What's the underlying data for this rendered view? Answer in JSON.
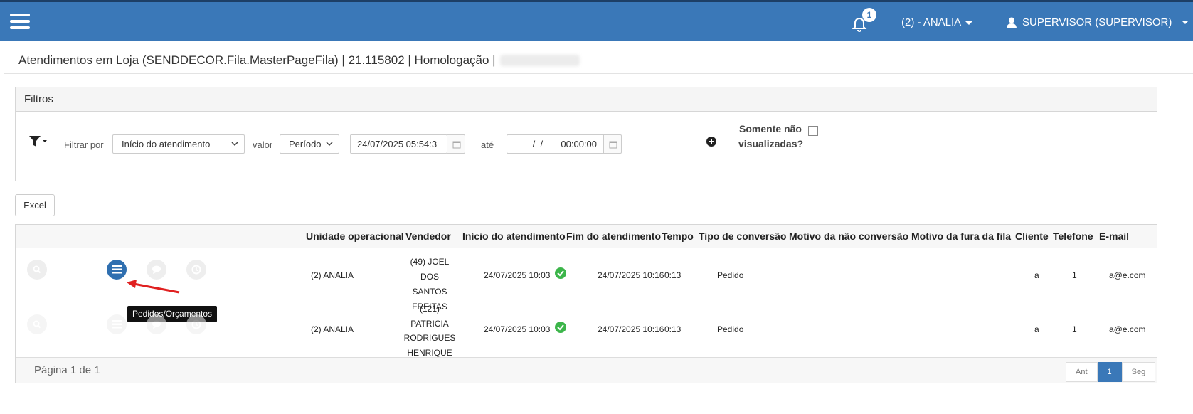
{
  "header": {
    "notifications_count": "1",
    "unit_menu_label": "(2) - ANALIA",
    "user_menu_label": "SUPERVISOR (SUPERVISOR)",
    "accent_color": "#3a78b8"
  },
  "page": {
    "title": "Atendimentos em Loja (SENDDECOR.Fila.MasterPageFila) | 21.115802 | Homologação |"
  },
  "filters": {
    "panel_title": "Filtros",
    "filter_by_label": "Filtrar por",
    "filter_by_value": "Início do atendimento",
    "value_label": "valor",
    "value_select": "Período",
    "date_from": "24/07/2025 05:54:3",
    "until_label": "até",
    "date_to": "  /  /       00:00:00",
    "only_unviewed_label": "Somente não visualizadas?"
  },
  "toolbar": {
    "excel_label": "Excel"
  },
  "table": {
    "columns": {
      "unit": "Unidade operacional",
      "seller": "Vendedor",
      "start": "Início do atendimento",
      "end": "Fim do atendimento",
      "time": "Tempo",
      "conversion_type": "Tipo de conversão",
      "no_conversion_reason": "Motivo da não conversão",
      "queue_skip_reason": "Motivo da fura da fila",
      "client": "Cliente",
      "phone": "Telefone",
      "email": "E-mail"
    },
    "rows": [
      {
        "unit": "(2) ANALIA",
        "seller": [
          "(49) JOEL",
          "DOS SANTOS",
          "FREITAS"
        ],
        "start": "24/07/2025 10:03",
        "end": "24/07/2025 10:16",
        "time": "0:13",
        "conversion_type": "Pedido",
        "client": "a",
        "phone": "1",
        "email": "a@e.com"
      },
      {
        "unit": "(2) ANALIA",
        "seller": [
          "(121)",
          "PATRICIA",
          "RODRIGUES",
          "HENRIQUE"
        ],
        "start": "24/07/2025 10:03",
        "end": "24/07/2025 10:16",
        "time": "0:13",
        "conversion_type": "Pedido",
        "client": "a",
        "phone": "1",
        "email": "a@e.com"
      }
    ],
    "tooltip": "Pedidos/Orçamentos",
    "page_info": "Página 1 de 1",
    "pager": {
      "prev": "Ant",
      "current": "1",
      "next": "Seg"
    }
  }
}
